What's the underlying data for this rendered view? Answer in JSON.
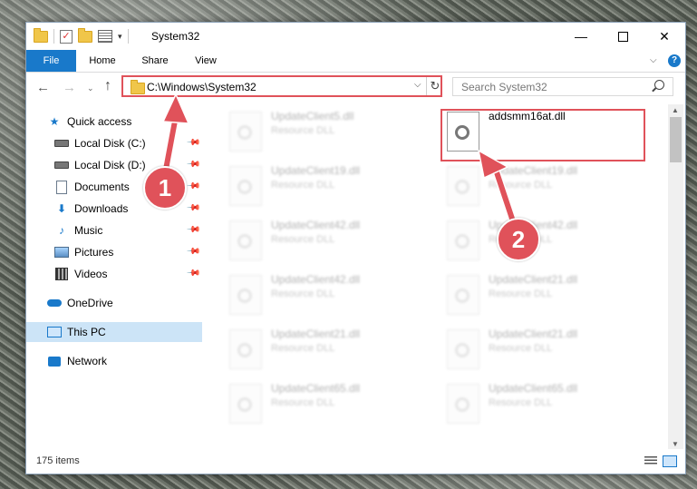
{
  "window": {
    "title": "System32",
    "minimize_glyph": "—",
    "close_glyph": "✕",
    "qat_dropdown_glyph": "▾"
  },
  "ribbon": {
    "tabs": [
      "File",
      "Home",
      "Share",
      "View"
    ],
    "help_glyph": "?",
    "chevron_glyph": "⌵"
  },
  "address": {
    "path": "C:\\Windows\\System32",
    "back_glyph": "←",
    "forward_glyph": "→",
    "recent_glyph": "⌄",
    "up_glyph": "↑",
    "dropdown_glyph": "⌵",
    "refresh_glyph": "↻"
  },
  "search": {
    "placeholder": "Search System32"
  },
  "navigation": {
    "quick_access": "Quick access",
    "items": [
      {
        "label": "Local Disk (C:)",
        "icon": "drive-icon",
        "pinned": true
      },
      {
        "label": "Local Disk (D:)",
        "icon": "drive-icon",
        "pinned": true
      },
      {
        "label": "Documents",
        "icon": "documents-icon",
        "pinned": true
      },
      {
        "label": "Downloads",
        "icon": "downloads-icon",
        "pinned": true
      },
      {
        "label": "Music",
        "icon": "music-icon",
        "pinned": true
      },
      {
        "label": "Pictures",
        "icon": "pictures-icon",
        "pinned": true
      },
      {
        "label": "Videos",
        "icon": "videos-icon",
        "pinned": true
      }
    ],
    "onedrive": "OneDrive",
    "this_pc": "This PC",
    "network": "Network",
    "star_glyph": "★",
    "pin_glyph": "📌",
    "music_glyph": "♪",
    "download_glyph": "⬇"
  },
  "files": {
    "left_column": [
      {
        "name": "UpdateClient5.dll",
        "type": "Resource DLL"
      },
      {
        "name": "UpdateClient19.dll",
        "type": "Resource DLL"
      },
      {
        "name": "UpdateClient42.dll",
        "type": "Resource DLL"
      },
      {
        "name": "UpdateClient42.dll",
        "type": "Resource DLL"
      },
      {
        "name": "UpdateClient21.dll",
        "type": "Resource DLL"
      },
      {
        "name": "UpdateClient65.dll",
        "type": "Resource DLL"
      }
    ],
    "right_column": [
      {
        "name": "addsmm16at.dll",
        "type": ""
      },
      {
        "name": "UpdateClient19.dll",
        "type": "Resource DLL"
      },
      {
        "name": "UpdateClient42.dll",
        "type": "Resource DLL"
      },
      {
        "name": "UpdateClient21.dll",
        "type": "Resource DLL"
      },
      {
        "name": "UpdateClient21.dll",
        "type": "Resource DLL"
      },
      {
        "name": "UpdateClient65.dll",
        "type": "Resource DLL"
      }
    ]
  },
  "scrollbar": {
    "up_glyph": "▲",
    "down_glyph": "▼"
  },
  "status": {
    "item_count": "175 items"
  },
  "callouts": {
    "step1": "1",
    "step2": "2",
    "color": "#e0525a"
  }
}
